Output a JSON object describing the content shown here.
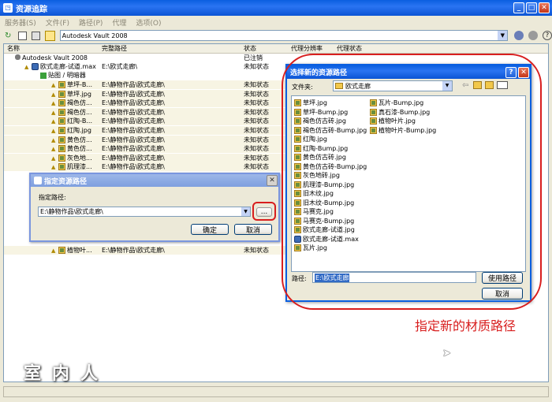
{
  "main_window": {
    "title": "资源追踪",
    "menu": [
      "服务器(S)",
      "文件(F)",
      "路径(P)",
      "代理",
      "选项(O)"
    ],
    "vault_label": "Autodesk Vault 2008",
    "columns": [
      "名称",
      "完整路径",
      "状态",
      "代理分辨率",
      "代理状态"
    ],
    "tree_root": {
      "name": "Autodesk Vault 2008",
      "status": "已注销"
    },
    "tree_file": {
      "name": "欧式走廊-试道.max",
      "path": "E:\\欧式走廊\\",
      "status": "未知状态"
    },
    "tree_group": "贴图 / 明暗器",
    "rows": [
      {
        "name": "草坪-B...",
        "path": "E:\\静物作品\\欧式走廊\\",
        "status": "未知状态"
      },
      {
        "name": "草坪.jpg",
        "path": "E:\\静物作品\\欧式走廊\\",
        "status": "未知状态"
      },
      {
        "name": "褐色仿...",
        "path": "E:\\静物作品\\欧式走廊\\",
        "status": "未知状态"
      },
      {
        "name": "褐色仿...",
        "path": "E:\\静物作品\\欧式走廊\\",
        "status": "未知状态"
      },
      {
        "name": "红陶-B...",
        "path": "E:\\静物作品\\欧式走廊\\",
        "status": "未知状态"
      },
      {
        "name": "红陶.jpg",
        "path": "E:\\静物作品\\欧式走廊\\",
        "status": "未知状态"
      },
      {
        "name": "黄色仿...",
        "path": "E:\\静物作品\\欧式走廊\\",
        "status": "未知状态"
      },
      {
        "name": "黄色仿...",
        "path": "E:\\静物作品\\欧式走廊\\",
        "status": "未知状态"
      },
      {
        "name": "灰色地...",
        "path": "E:\\静物作品\\欧式走廊\\",
        "status": "未知状态"
      },
      {
        "name": "肌理漆...",
        "path": "E:\\静物作品\\欧式走廊\\",
        "status": "未知状态"
      }
    ],
    "bottom_row": {
      "name": "植物叶...",
      "path": "E:\\静物作品\\欧式走廊\\",
      "status": "未知状态"
    }
  },
  "specify_dialog": {
    "title": "指定资源路径",
    "label": "指定路径:",
    "path_value": "E:\\静物作品\\欧式走廊\\",
    "browse_label": "...",
    "ok_label": "确定",
    "cancel_label": "取消"
  },
  "select_dialog": {
    "title": "选择新的资源路径",
    "look_in_label": "文件夹:",
    "look_in_value": "欧式走廊",
    "files_col1": [
      "草坪.jpg",
      "草坪-Bump.jpg",
      "褐色仿古砖.jpg",
      "褐色仿古砖-Bump.jpg",
      "红陶.jpg",
      "红陶-Bump.jpg",
      "黄色仿古砖.jpg",
      "黄色仿古砖-Bump.jpg",
      "灰色地砖.jpg",
      "肌理漆-Bump.jpg",
      "旧木纹.jpg",
      "旧木纹-Bump.jpg",
      "马赛克.jpg",
      "马赛克-Bump.jpg",
      "欧式走廊-试道.jpg",
      "欧式走廊-试道.max",
      "瓦片.jpg"
    ],
    "files_col2": [
      "瓦片-Bump.jpg",
      "真石漆-Bump.jpg",
      "植物叶片.jpg",
      "植物叶片-Bump.jpg"
    ],
    "path_label": "路径:",
    "path_value": "E:\\欧式走廊",
    "use_path_label": "使用路径",
    "cancel_label": "取消"
  },
  "annotation": "指定新的材质路径",
  "watermark": "室内人",
  "colors": {
    "annotation_red": "#D81E1E",
    "xp_blue": "#0A5FE0"
  }
}
